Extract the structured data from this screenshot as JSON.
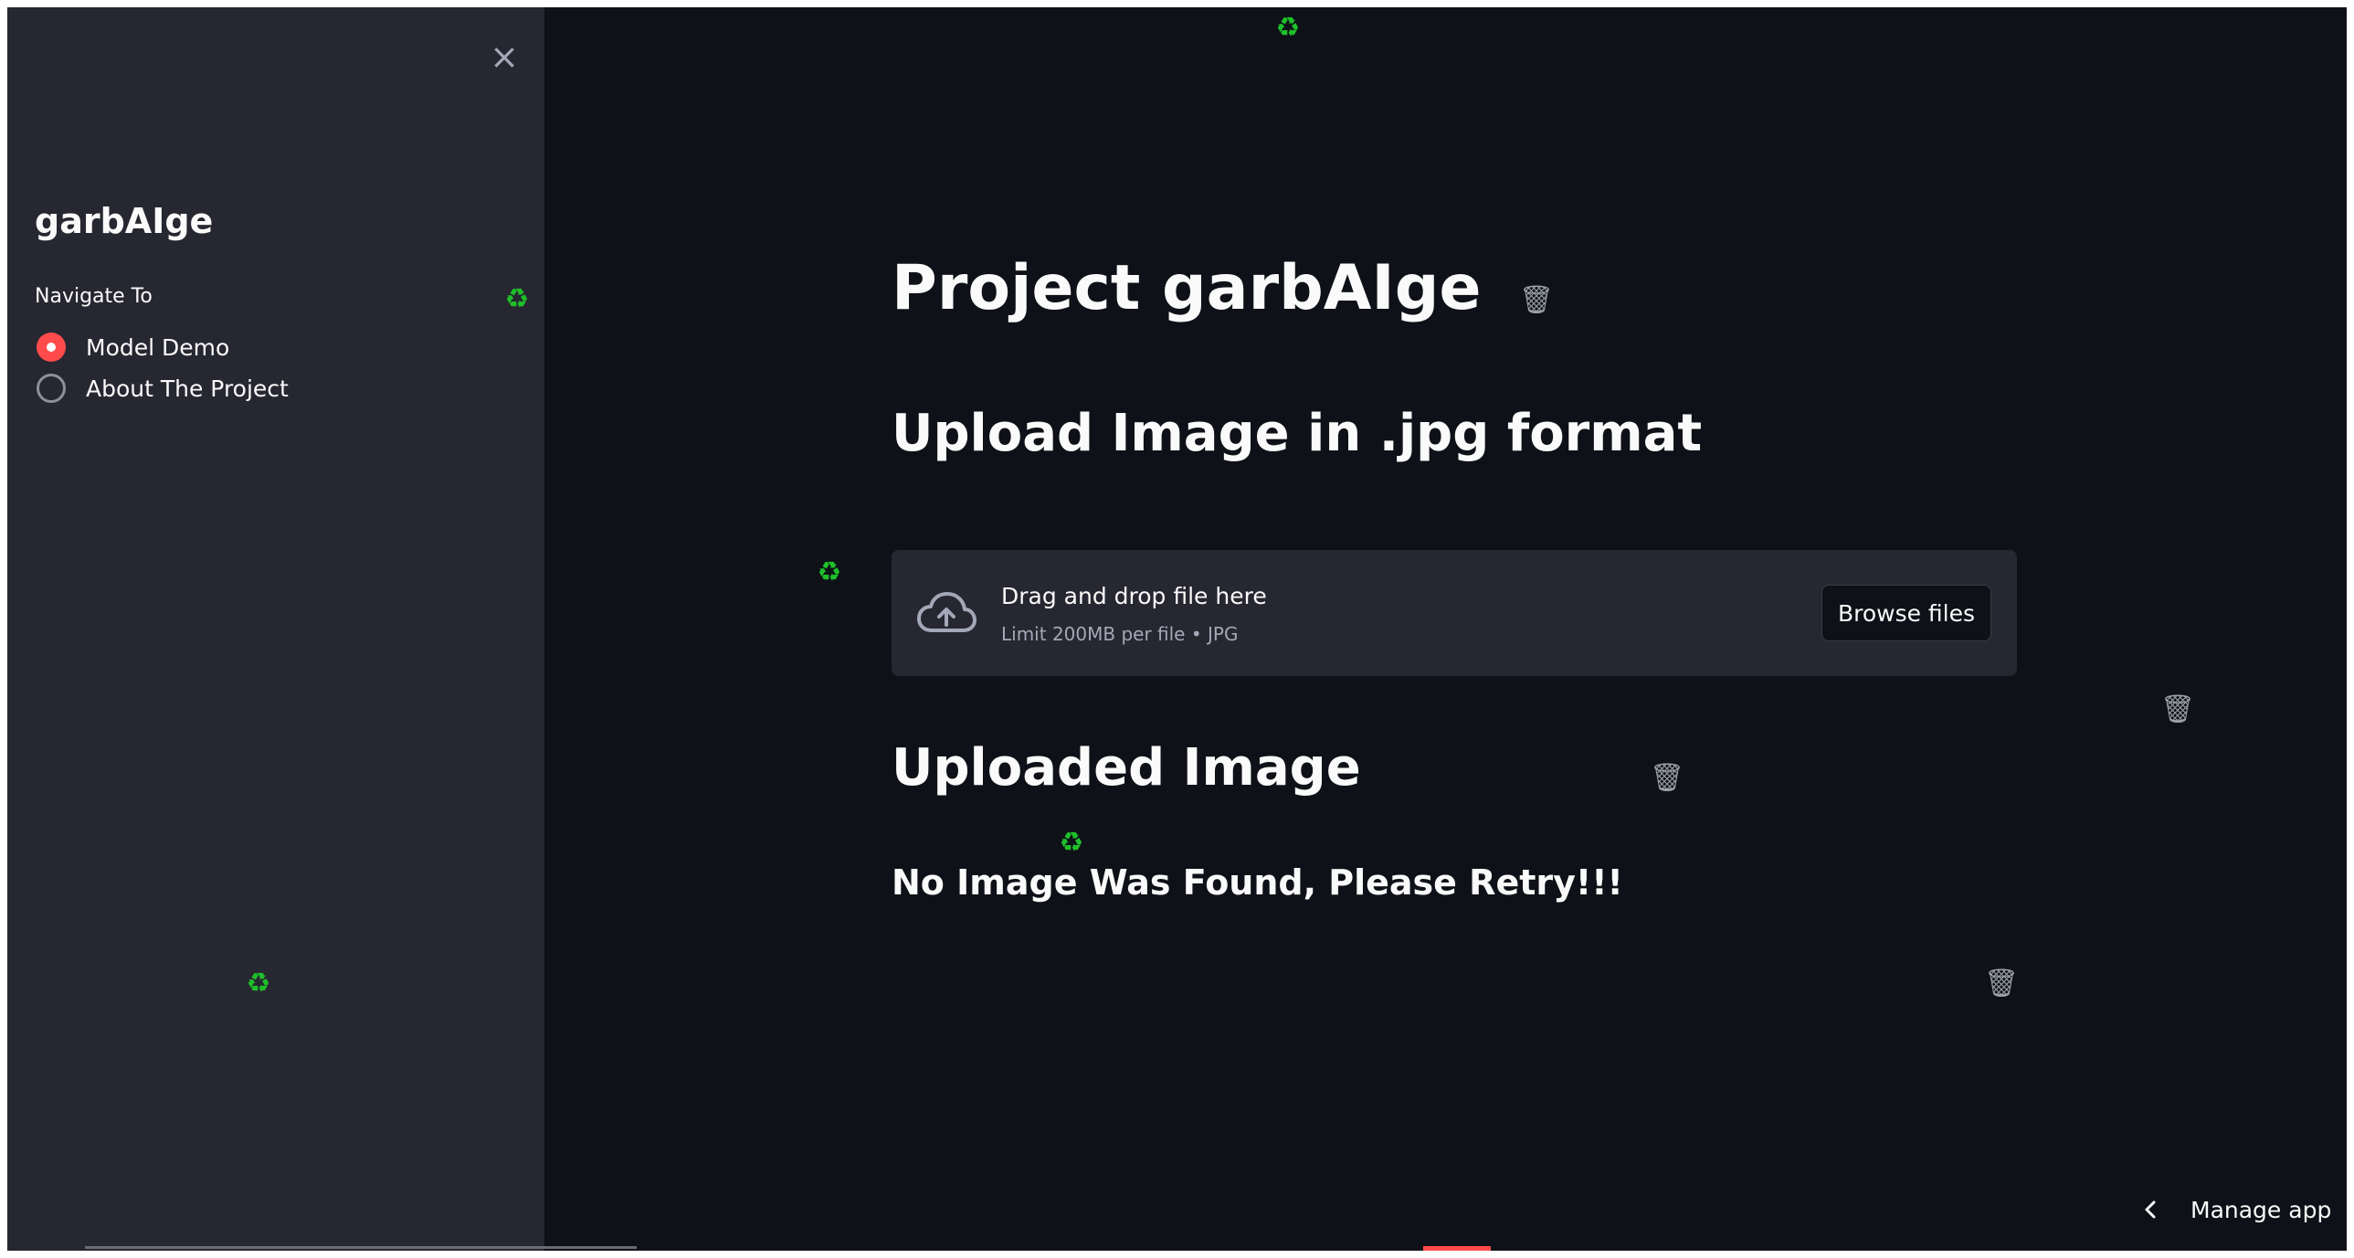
{
  "sidebar": {
    "close_icon": "×",
    "title": "garbAIge",
    "nav_label": "Navigate To",
    "nav_options": [
      {
        "label": "Model Demo",
        "selected": true
      },
      {
        "label": "About The Project",
        "selected": false
      }
    ]
  },
  "main": {
    "title": "Project garbAIge",
    "upload_heading": "Upload Image in .jpg format",
    "uploader": {
      "icon": "cloud-upload-icon",
      "drop_text": "Drag and drop file here",
      "limit_text": "Limit 200MB per file • JPG",
      "browse_label": "Browse files"
    },
    "uploaded_heading": "Uploaded Image",
    "no_image_text": "No Image Was Found, Please Retry!!!"
  },
  "decorations": {
    "recycle_glyph": "♻",
    "bin_glyph": "🗑"
  },
  "footer": {
    "manage_app_label": "Manage app"
  },
  "colors": {
    "accent": "#ff4b4b",
    "background": "#0e1117",
    "sidebar": "#262730",
    "text": "#fafafa",
    "recycle": "#1fbf2a"
  }
}
